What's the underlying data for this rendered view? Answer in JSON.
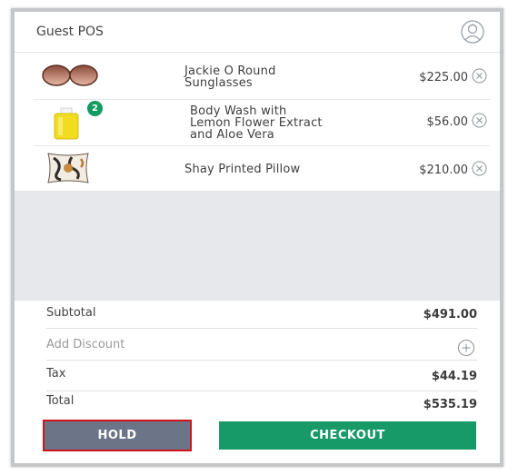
{
  "header": {
    "title": "Guest POS",
    "user_icon": "user-circle-icon"
  },
  "cart": {
    "items": [
      {
        "name": "Jackie O Round Sunglasses",
        "name_lines": [
          "Jackie O Round",
          "Sunglasses"
        ],
        "price": "$225.00",
        "thumb": "sunglasses",
        "quantity_badge": ""
      },
      {
        "name": "Body Wash with Lemon Flower Extract and Aloe Vera",
        "name_lines": [
          "Body Wash with",
          "Lemon Flower Extract",
          "and Aloe Vera"
        ],
        "price": "$56.00",
        "thumb": "body-wash-bottle",
        "quantity_badge": "2"
      },
      {
        "name": "Shay Printed Pillow",
        "name_lines": [
          "Shay Printed Pillow"
        ],
        "price": "$210.00",
        "thumb": "printed-pillow",
        "quantity_badge": ""
      }
    ]
  },
  "summary": {
    "subtotal_label": "Subtotal",
    "subtotal_value": "$491.00",
    "discount_label": "Add Discount",
    "tax_label": "Tax",
    "tax_value": "$44.19",
    "total_label": "Total",
    "total_value": "$535.19"
  },
  "actions": {
    "hold_label": "HOLD",
    "checkout_label": "CHECKOUT"
  },
  "colors": {
    "checkout": "#179a68",
    "hold": "#6c7587",
    "hold_highlight": "#d0141c",
    "badge": "#149a63",
    "empty_area": "#e6e8eb"
  }
}
